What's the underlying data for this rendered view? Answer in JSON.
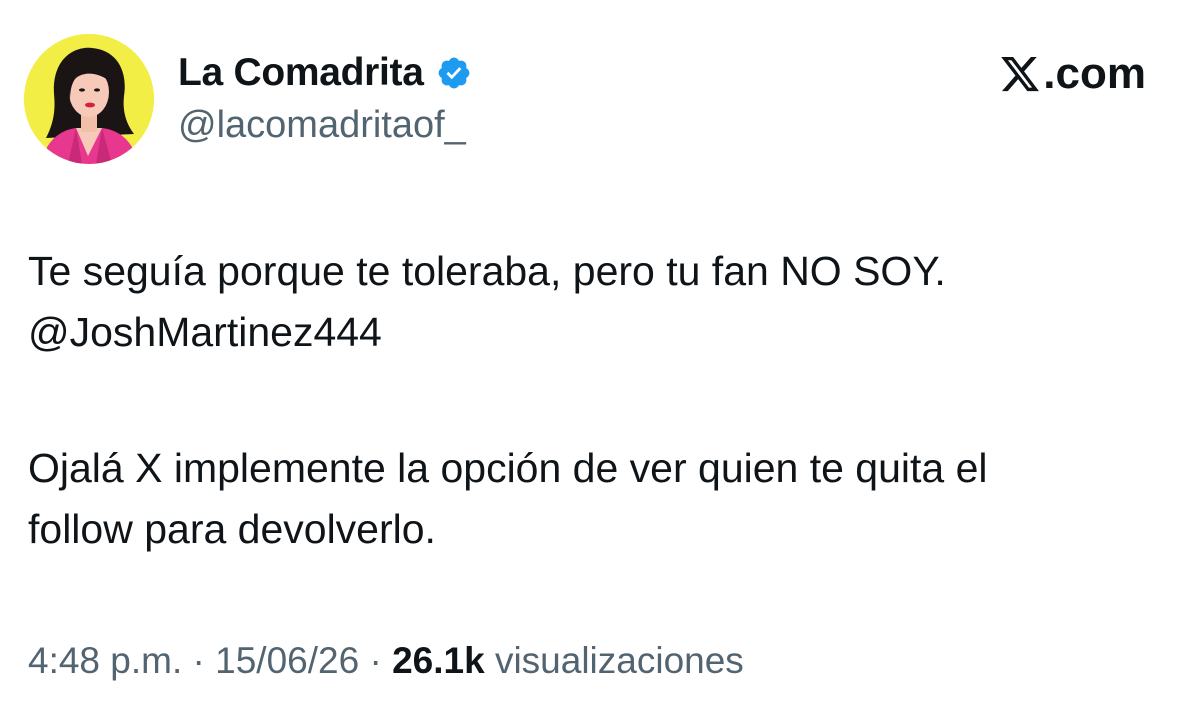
{
  "author": {
    "display_name": "La Comadrita",
    "handle": "@lacomadritaof_",
    "verified": true,
    "avatar_bg_color": "#f3ee45"
  },
  "brand": {
    "label": ".com",
    "logo_icon": "x-logo-icon"
  },
  "tweet": {
    "lines": [
      "Te seguía porque te toleraba, pero tu fan NO SOY.",
      "@JoshMartinez444",
      "Ojalá X implemente la opción de ver quien te quita el",
      "follow para devolverlo."
    ]
  },
  "meta": {
    "time": "4:48 p.m.",
    "separator": " · ",
    "date": "15/06/26",
    "views_count": "26.1k",
    "views_label": "visualizaciones"
  },
  "colors": {
    "text_primary": "#0f1419",
    "text_secondary": "#536471",
    "verified_blue": "#1d9bf0"
  }
}
